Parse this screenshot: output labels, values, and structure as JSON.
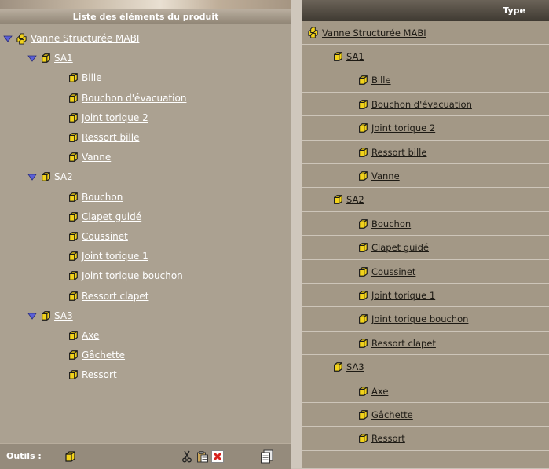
{
  "left_panel": {
    "header": "Liste des éléments du produit",
    "footer_label": "Outils :"
  },
  "right_panel": {
    "header": "Type"
  },
  "tree": [
    {
      "label": "Vanne Structurée MABI",
      "level": 0,
      "kind": "assembly",
      "expanded": true
    },
    {
      "label": "SA1",
      "level": 1,
      "kind": "part",
      "expanded": true
    },
    {
      "label": "Bille",
      "level": 2,
      "kind": "part"
    },
    {
      "label": "Bouchon d'évacuation",
      "level": 2,
      "kind": "part"
    },
    {
      "label": "Joint torique 2",
      "level": 2,
      "kind": "part"
    },
    {
      "label": "Ressort bille",
      "level": 2,
      "kind": "part"
    },
    {
      "label": "Vanne",
      "level": 2,
      "kind": "part"
    },
    {
      "label": "SA2",
      "level": 1,
      "kind": "part",
      "expanded": true
    },
    {
      "label": "Bouchon",
      "level": 2,
      "kind": "part"
    },
    {
      "label": "Clapet guidé",
      "level": 2,
      "kind": "part"
    },
    {
      "label": "Coussinet",
      "level": 2,
      "kind": "part"
    },
    {
      "label": "Joint torique 1",
      "level": 2,
      "kind": "part"
    },
    {
      "label": "Joint torique bouchon",
      "level": 2,
      "kind": "part"
    },
    {
      "label": "Ressort clapet",
      "level": 2,
      "kind": "part"
    },
    {
      "label": "SA3",
      "level": 1,
      "kind": "part",
      "expanded": true
    },
    {
      "label": "Axe",
      "level": 2,
      "kind": "part"
    },
    {
      "label": "Gâchette",
      "level": 2,
      "kind": "part"
    },
    {
      "label": "Ressort",
      "level": 2,
      "kind": "part"
    }
  ],
  "toolbar_icons": [
    "new-part-icon",
    "cut-icon",
    "paste-icon",
    "delete-icon",
    "copy-icon"
  ],
  "colors": {
    "cube": "#f2d21b",
    "cube_edge": "#1a1a1a",
    "delete_red": "#d8231f"
  }
}
